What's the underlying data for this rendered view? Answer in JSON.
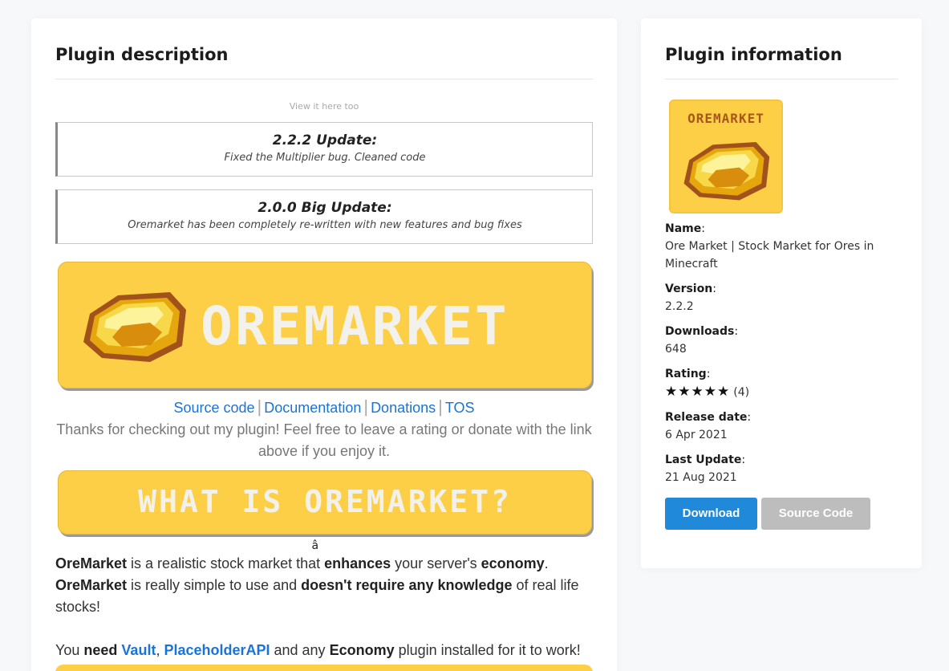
{
  "main": {
    "title": "Plugin description",
    "view_note": "View it here too",
    "updates": [
      {
        "title": "2.2.2 Update:",
        "text": "Fixed the Multiplier bug. Cleaned code"
      },
      {
        "title": "2.0.0 Big Update:",
        "text": "Oremarket has been completely re-written with new features and bug fixes"
      }
    ],
    "banner_text": "OREMARKET",
    "links": [
      "Source code",
      "Documentation",
      "Donations",
      "TOS"
    ],
    "link_separator": "|",
    "thanks": "Thanks for checking out my plugin! Feel free to leave a rating or donate with the link above if you enjoy it.",
    "what_banner_text": "WHAT IS OREMARKET?",
    "glyph": "â",
    "para1": {
      "w1": "OreMarket",
      "t1": " is a realistic stock market that ",
      "w2": "enhances",
      "t2": " your server's ",
      "w3": "economy",
      "t3": "."
    },
    "para2": {
      "w1": "OreMarket",
      "t1": " is really simple to use and ",
      "w2": "doesn't require any knowledge",
      "t2": " of real life stocks!"
    },
    "para3": {
      "t0": "You ",
      "w1": "need",
      "t1": " ",
      "l1": "Vault",
      "t2": ", ",
      "l2": "PlaceholderAPI",
      "t3": " and any ",
      "w2": "Economy",
      "t4": " plugin installed for it to work!"
    }
  },
  "side": {
    "title": "Plugin information",
    "logo_text": "OREMARKET",
    "fields": {
      "name_label": "Name",
      "name_value": "Ore Market | Stock Market for Ores in Minecraft",
      "version_label": "Version",
      "version_value": "2.2.2",
      "downloads_label": "Downloads",
      "downloads_value": "648",
      "rating_label": "Rating",
      "rating_stars": 5,
      "rating_count": "(4)",
      "release_label": "Release date",
      "release_value": "6 Apr 2021",
      "update_label": "Last Update",
      "update_value": "21 Aug 2021"
    },
    "colon": ":",
    "download_button": "Download",
    "source_button": "Source Code"
  },
  "colors": {
    "accent_blue": "#2189d9",
    "link_blue": "#1a74d6",
    "banner_yellow": "#fdcf46",
    "disabled_gray": "#bdbdbd"
  }
}
